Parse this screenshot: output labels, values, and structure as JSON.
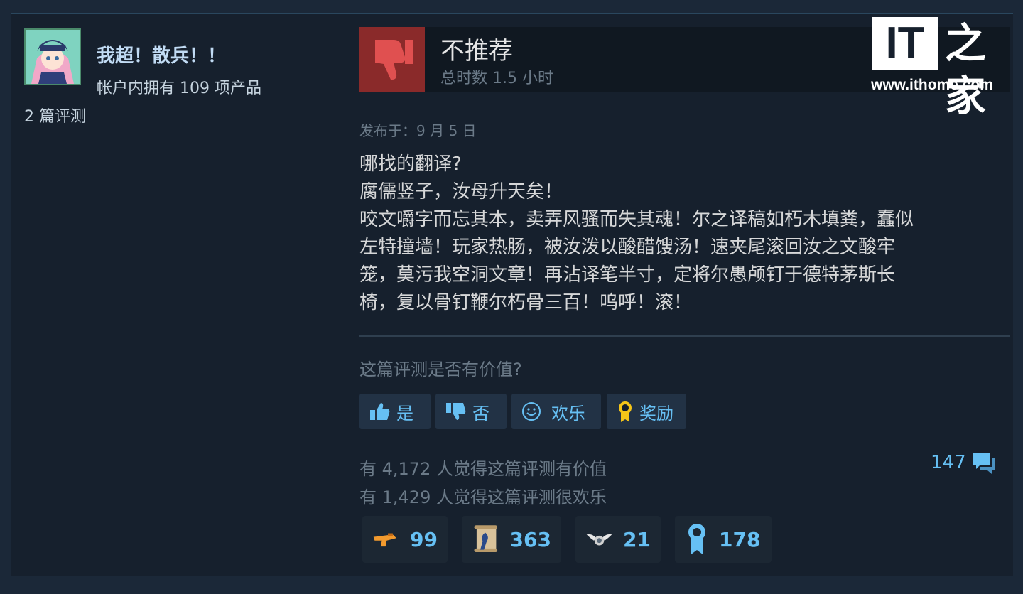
{
  "author": {
    "name": "我超！散兵！！",
    "products": "帐户内拥有 109 项产品",
    "reviews": "2 篇评测"
  },
  "review": {
    "recommendation": "不推荐",
    "playtime": "总时数 1.5 小时",
    "posted": "发布于：9 月 5 日",
    "lines": [
      "哪找的翻译?",
      "腐儒竖子，汝母升天矣！",
      "咬文嚼字而忘其本，卖弄风骚而失其魂！尔之译稿如朽木填粪，蠢似",
      "左特撞墙！玩家热肠，被汝泼以酸醋馊汤！速夹尾滚回汝之文酸牢",
      "笼，莫污我空洞文章！再沾译笔半寸，定将尔愚颅钉于德特茅斯长",
      "椅，复以骨钉鞭尔朽骨三百！呜呼！滚！"
    ]
  },
  "feedback": {
    "question": "这篇评测是否有价值?",
    "yes": "是",
    "no": "否",
    "funny": "欢乐",
    "award": "奖励"
  },
  "stats": {
    "helpful": "有 4,172 人觉得这篇评测有价值",
    "funny": "有 1,429 人觉得这篇评测很欢乐",
    "comments": "147"
  },
  "awards": [
    {
      "icon": "golden-gun-icon",
      "count": "99"
    },
    {
      "icon": "scroll-icon",
      "count": "363"
    },
    {
      "icon": "winged-emblem-icon",
      "count": "21"
    },
    {
      "icon": "ribbon-medal-icon",
      "count": "178"
    }
  ],
  "watermark": {
    "logo": "IT",
    "logo_char": "之家",
    "url": "www.ithome.com"
  },
  "colors": {
    "background": "#1b2838",
    "panel": "#16202d",
    "accent": "#66c0f4",
    "not_recommended": "#8a2a2a"
  }
}
